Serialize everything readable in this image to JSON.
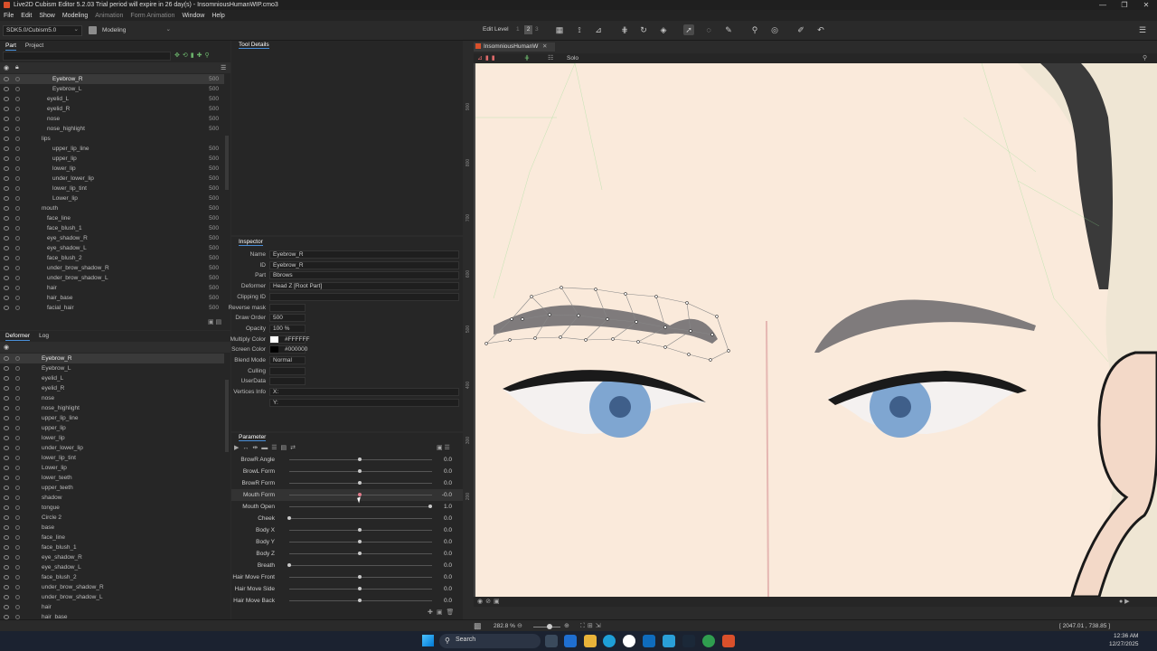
{
  "window": {
    "title": "Live2D Cubism Editor 5.2.03   Trial period will expire in 26 day(s)  -  InsomniousHumanWIP.cmo3",
    "controls": [
      "—",
      "❐",
      "✕"
    ]
  },
  "menu": [
    "File",
    "Edit",
    "Show",
    "Modeling",
    "Animation",
    "Form Animation",
    "Window",
    "Help"
  ],
  "toolbar": {
    "sdk": "SDK5.0/Cubism5.0",
    "workspace": "Modeling",
    "edit_level_label": "Edit Level",
    "edit_levels": [
      "1",
      "2",
      "3"
    ]
  },
  "part_panel": {
    "tabs": [
      "Part",
      "Project"
    ],
    "items": [
      {
        "name": "Eyebrow_R",
        "val": "500",
        "indent": 2,
        "sel": true
      },
      {
        "name": "Eyebrow_L",
        "val": "500",
        "indent": 2
      },
      {
        "name": "eyelid_L",
        "val": "500",
        "indent": 1
      },
      {
        "name": "eyelid_R",
        "val": "500",
        "indent": 1
      },
      {
        "name": "nose",
        "val": "500",
        "indent": 1
      },
      {
        "name": "nose_highlight",
        "val": "500",
        "indent": 1
      },
      {
        "name": "lips",
        "val": "",
        "indent": 0
      },
      {
        "name": "upper_lip_line",
        "val": "500",
        "indent": 2
      },
      {
        "name": "upper_lip",
        "val": "500",
        "indent": 2
      },
      {
        "name": "lower_lip",
        "val": "500",
        "indent": 2
      },
      {
        "name": "under_lower_lip",
        "val": "500",
        "indent": 2
      },
      {
        "name": "lower_lip_tint",
        "val": "500",
        "indent": 2
      },
      {
        "name": "Lower_lip",
        "val": "500",
        "indent": 2
      },
      {
        "name": "mouth",
        "val": "500",
        "indent": 0
      },
      {
        "name": "face_line",
        "val": "500",
        "indent": 1
      },
      {
        "name": "face_blush_1",
        "val": "500",
        "indent": 1
      },
      {
        "name": "eye_shadow_R",
        "val": "500",
        "indent": 1
      },
      {
        "name": "eye_shadow_L",
        "val": "500",
        "indent": 1
      },
      {
        "name": "face_blush_2",
        "val": "500",
        "indent": 1
      },
      {
        "name": "under_brow_shadow_R",
        "val": "500",
        "indent": 1
      },
      {
        "name": "under_brow_shadow_L",
        "val": "500",
        "indent": 1
      },
      {
        "name": "hair",
        "val": "500",
        "indent": 1
      },
      {
        "name": "hair_base",
        "val": "500",
        "indent": 1
      },
      {
        "name": "facial_hair",
        "val": "500",
        "indent": 1
      }
    ]
  },
  "deformer_panel": {
    "tabs": [
      "Deformer",
      "Log"
    ],
    "items": [
      {
        "name": "Eyebrow_R",
        "sel": true
      },
      {
        "name": "Eyebrow_L"
      },
      {
        "name": "eyelid_L"
      },
      {
        "name": "eyelid_R"
      },
      {
        "name": "nose"
      },
      {
        "name": "nose_highlight"
      },
      {
        "name": "upper_lip_line"
      },
      {
        "name": "upper_lip"
      },
      {
        "name": "lower_lip"
      },
      {
        "name": "under_lower_lip"
      },
      {
        "name": "lower_lip_tint"
      },
      {
        "name": "Lower_lip"
      },
      {
        "name": "lower_teeth"
      },
      {
        "name": "upper_teeth"
      },
      {
        "name": "shadow"
      },
      {
        "name": "tongue"
      },
      {
        "name": "Circle 2"
      },
      {
        "name": "base"
      },
      {
        "name": "face_line"
      },
      {
        "name": "face_blush_1"
      },
      {
        "name": "eye_shadow_R"
      },
      {
        "name": "eye_shadow_L"
      },
      {
        "name": "face_blush_2"
      },
      {
        "name": "under_brow_shadow_R"
      },
      {
        "name": "under_brow_shadow_L"
      },
      {
        "name": "hair"
      },
      {
        "name": "hair_base"
      }
    ]
  },
  "tool_details": {
    "title": "Tool Details"
  },
  "inspector": {
    "title": "Inspector",
    "rows": [
      {
        "label": "Name",
        "value": "Eyebrow_R"
      },
      {
        "label": "ID",
        "value": "Eyebrow_R"
      },
      {
        "label": "Part",
        "value": "Bbrows"
      },
      {
        "label": "Deformer",
        "value": "Head Z  [Root Part]"
      },
      {
        "label": "Clipping ID",
        "value": ""
      },
      {
        "label": "Reverse mask",
        "value": ""
      },
      {
        "label": "Draw Order",
        "value": "500"
      },
      {
        "label": "Opacity",
        "value": "100 %"
      },
      {
        "label": "Multiply Color",
        "value": "#FFFFFF"
      },
      {
        "label": "Screen Color",
        "value": "#000000"
      },
      {
        "label": "Blend Mode",
        "value": "Normal"
      },
      {
        "label": "Culling",
        "value": ""
      },
      {
        "label": "UserData",
        "value": ""
      },
      {
        "label": "Vertices Info",
        "value": "X:"
      },
      {
        "label": "",
        "value": "Y:"
      }
    ]
  },
  "parameter": {
    "title": "Parameter",
    "rows": [
      {
        "label": "BrowR Angle",
        "value": "0.0",
        "pos": 0.5
      },
      {
        "label": "BrowL Form",
        "value": "0.0",
        "pos": 0.5
      },
      {
        "label": "BrowR Form",
        "value": "0.0",
        "pos": 0.5
      },
      {
        "label": "Mouth Form",
        "value": "-0.0",
        "pos": 0.5,
        "sel": true
      },
      {
        "label": "Mouth Open",
        "value": "1.0",
        "pos": 1.0
      },
      {
        "label": "Cheek",
        "value": "0.0",
        "pos": 0.0
      },
      {
        "label": "Body X",
        "value": "0.0",
        "pos": 0.5
      },
      {
        "label": "Body Y",
        "value": "0.0",
        "pos": 0.5
      },
      {
        "label": "Body Z",
        "value": "0.0",
        "pos": 0.5
      },
      {
        "label": "Breath",
        "value": "0.0",
        "pos": 0.0
      },
      {
        "label": "Hair Move Front",
        "value": "0.0",
        "pos": 0.5
      },
      {
        "label": "Hair Move Side",
        "value": "0.0",
        "pos": 0.5
      },
      {
        "label": "Hair Move Back",
        "value": "0.0",
        "pos": 0.5
      }
    ]
  },
  "canvas": {
    "tab": "InsomniousHumanW",
    "solo": "Solo",
    "zoom": "282.8 %",
    "coords": "[ 2047.01 , 738.85 ]",
    "ruler": [
      "900",
      "800",
      "700",
      "600",
      "500",
      "400",
      "300",
      "200"
    ]
  },
  "taskbar": {
    "search": "Search",
    "time": "12:36 AM",
    "date": "12/27/2025"
  },
  "colors": {
    "skin": "#faeadb",
    "brow": "#7f7b7c",
    "iris": "#7fa6d1",
    "mesh": "#8be08b"
  }
}
